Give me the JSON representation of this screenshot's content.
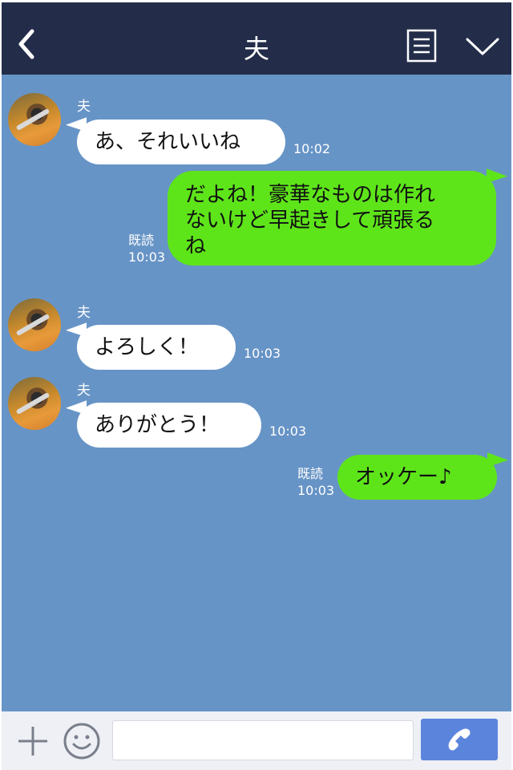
{
  "header": {
    "title": "夫",
    "back_icon": "chevron-left-icon",
    "menu_icon": "list-icon",
    "collapse_icon": "chevron-down-icon"
  },
  "messages": [
    {
      "direction": "in",
      "sender": "夫",
      "text": "あ、それいいね",
      "time": "10:02"
    },
    {
      "direction": "out",
      "read": "既読",
      "text": "だよね！豪華なものは作れ\nないけど早起きして頑張る\nね",
      "time": "10:03"
    },
    {
      "direction": "in",
      "sender": "夫",
      "text": "よろしく！",
      "time": "10:03"
    },
    {
      "direction": "in",
      "sender": "夫",
      "text": "ありがとう！",
      "time": "10:03"
    },
    {
      "direction": "out",
      "read": "既読",
      "text": "オッケー♪",
      "time": "10:03"
    }
  ],
  "input_bar": {
    "plus_icon": "plus-icon",
    "emoji_icon": "smiley-icon",
    "message_value": "",
    "call_icon": "phone-icon"
  },
  "colors": {
    "header_bg": "#232d4a",
    "chat_bg": "#6794c6",
    "outgoing_bubble": "#5ee51a",
    "incoming_bubble": "#ffffff",
    "call_button": "#5b84dd"
  }
}
